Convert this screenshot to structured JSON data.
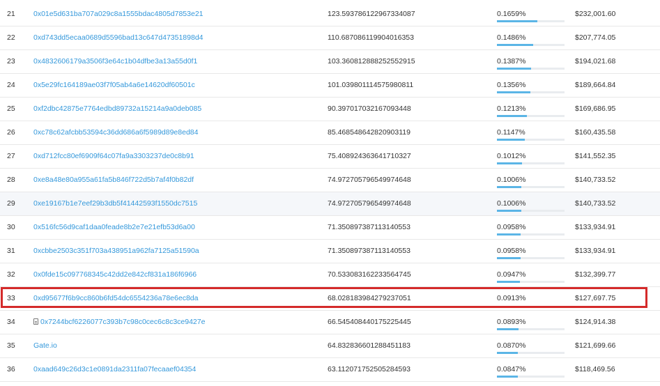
{
  "colors": {
    "link": "#3498db",
    "highlight": "#d42a2a",
    "bar_fill": "#5bb5e6",
    "bar_track": "#e9ecef"
  },
  "holders": {
    "rows": [
      {
        "rank": "21",
        "address": "0x01e5d631ba707a029c8a1555bdac4805d7853e21",
        "quantity": "123.593786122967334087",
        "percentage": "0.1659%",
        "value": "$232,001.60",
        "pct": 0.1659
      },
      {
        "rank": "22",
        "address": "0xd743dd5ecaa0689d5596bad13c647d47351898d4",
        "quantity": "110.687086119904016353",
        "percentage": "0.1486%",
        "value": "$207,774.05",
        "pct": 0.1486
      },
      {
        "rank": "23",
        "address": "0x4832606179a3506f3e64c1b04dfbe3a13a55d0f1",
        "quantity": "103.360812888252552915",
        "percentage": "0.1387%",
        "value": "$194,021.68",
        "pct": 0.1387
      },
      {
        "rank": "24",
        "address": "0x5e29fc164189ae03f7f05ab4a6e14620df60501c",
        "quantity": "101.039801114575980811",
        "percentage": "0.1356%",
        "value": "$189,664.84",
        "pct": 0.1356
      },
      {
        "rank": "25",
        "address": "0xf2dbc42875e7764edbd89732a15214a9a0deb085",
        "quantity": "90.397017032167093448",
        "percentage": "0.1213%",
        "value": "$169,686.95",
        "pct": 0.1213
      },
      {
        "rank": "26",
        "address": "0xc78c62afcbb53594c36dd686a6f5989d89e8ed84",
        "quantity": "85.468548642820903119",
        "percentage": "0.1147%",
        "value": "$160,435.58",
        "pct": 0.1147
      },
      {
        "rank": "27",
        "address": "0xd712fcc80ef6909f64c07fa9a3303237de0c8b91",
        "quantity": "75.408924363641710327",
        "percentage": "0.1012%",
        "value": "$141,552.35",
        "pct": 0.1012
      },
      {
        "rank": "28",
        "address": "0xe8a48e80a955a61fa5b846f722d5b7af4f0b82df",
        "quantity": "74.972705796549974648",
        "percentage": "0.1006%",
        "value": "$140,733.52",
        "pct": 0.1006
      },
      {
        "rank": "29",
        "address": "0xe19167b1e7eef29b3db5f41442593f1550dc7515",
        "quantity": "74.972705796549974648",
        "percentage": "0.1006%",
        "value": "$140,733.52",
        "pct": 0.1006
      },
      {
        "rank": "30",
        "address": "0x516fc56d9caf1daa0feade8b2e7e21efb53d6a00",
        "quantity": "71.350897387113140553",
        "percentage": "0.0958%",
        "value": "$133,934.91",
        "pct": 0.0958
      },
      {
        "rank": "31",
        "address": "0xcbbe2503c351f703a438951a962fa7125a51590a",
        "quantity": "71.350897387113140553",
        "percentage": "0.0958%",
        "value": "$133,934.91",
        "pct": 0.0958
      },
      {
        "rank": "32",
        "address": "0x0fde15c097768345c42dd2e842cf831a186f6966",
        "quantity": "70.533083162233564745",
        "percentage": "0.0947%",
        "value": "$132,399.77",
        "pct": 0.0947
      },
      {
        "rank": "33",
        "address": "0xd95677f6b9cc860b6fd54dc6554236a78e6ec8da",
        "quantity": "68.028183984279237051",
        "percentage": "0.0913%",
        "value": "$127,697.75",
        "pct": 0.0913
      },
      {
        "rank": "34",
        "address": "0x7244bcf6226077c393b7c98c0cec6c8c3ce9427e",
        "quantity": "66.545408440175225445",
        "percentage": "0.0893%",
        "value": "$124,914.38",
        "pct": 0.0893
      },
      {
        "rank": "35",
        "address": "Gate.io",
        "quantity": "64.832836601288451183",
        "percentage": "0.0870%",
        "value": "$121,699.66",
        "pct": 0.087
      },
      {
        "rank": "36",
        "address": "0xaad649c26d3c1e0891da2311fa07fecaaef04354",
        "quantity": "63.112071752505284593",
        "percentage": "0.0847%",
        "value": "$118,469.56",
        "pct": 0.0847
      }
    ]
  }
}
